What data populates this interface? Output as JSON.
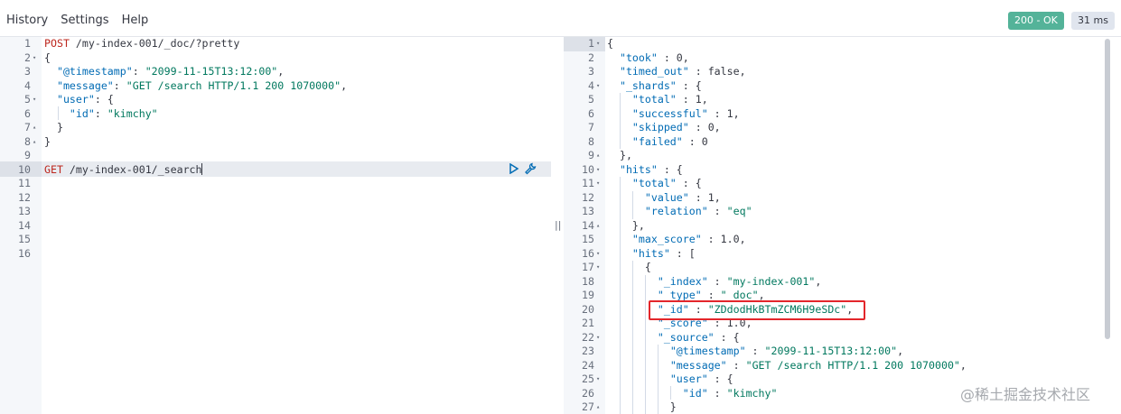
{
  "menu": {
    "history": "History",
    "settings": "Settings",
    "help": "Help"
  },
  "status": {
    "code": "200 - OK",
    "time": "31 ms",
    "ok_color": "#54b399"
  },
  "request": {
    "lines": [
      {
        "n": "1",
        "fold": "",
        "text": "POST /my-index-001/_doc/?pretty"
      },
      {
        "n": "2",
        "fold": "▾",
        "text": "{"
      },
      {
        "n": "3",
        "fold": "",
        "text": "  \"@timestamp\": \"2099-11-15T13:12:00\","
      },
      {
        "n": "4",
        "fold": "",
        "text": "  \"message\": \"GET /search HTTP/1.1 200 1070000\","
      },
      {
        "n": "5",
        "fold": "▾",
        "text": "  \"user\": {"
      },
      {
        "n": "6",
        "fold": "",
        "text": "    \"id\": \"kimchy\""
      },
      {
        "n": "7",
        "fold": "▴",
        "text": "  }"
      },
      {
        "n": "8",
        "fold": "▴",
        "text": "}"
      },
      {
        "n": "9",
        "fold": "",
        "text": ""
      },
      {
        "n": "10",
        "fold": "",
        "text": "GET /my-index-001/_search"
      },
      {
        "n": "11",
        "fold": "",
        "text": ""
      },
      {
        "n": "12",
        "fold": "",
        "text": ""
      },
      {
        "n": "13",
        "fold": "",
        "text": ""
      },
      {
        "n": "14",
        "fold": "",
        "text": ""
      },
      {
        "n": "15",
        "fold": "",
        "text": ""
      },
      {
        "n": "16",
        "fold": "",
        "text": ""
      }
    ]
  },
  "response": {
    "lines": [
      {
        "n": "1",
        "fold": "▾",
        "text": "{"
      },
      {
        "n": "2",
        "fold": "",
        "text": "  \"took\" : 0,"
      },
      {
        "n": "3",
        "fold": "",
        "text": "  \"timed_out\" : false,"
      },
      {
        "n": "4",
        "fold": "▾",
        "text": "  \"_shards\" : {"
      },
      {
        "n": "5",
        "fold": "",
        "text": "    \"total\" : 1,"
      },
      {
        "n": "6",
        "fold": "",
        "text": "    \"successful\" : 1,"
      },
      {
        "n": "7",
        "fold": "",
        "text": "    \"skipped\" : 0,"
      },
      {
        "n": "8",
        "fold": "",
        "text": "    \"failed\" : 0"
      },
      {
        "n": "9",
        "fold": "▴",
        "text": "  },"
      },
      {
        "n": "10",
        "fold": "▾",
        "text": "  \"hits\" : {"
      },
      {
        "n": "11",
        "fold": "▾",
        "text": "    \"total\" : {"
      },
      {
        "n": "12",
        "fold": "",
        "text": "      \"value\" : 1,"
      },
      {
        "n": "13",
        "fold": "",
        "text": "      \"relation\" : \"eq\""
      },
      {
        "n": "14",
        "fold": "▴",
        "text": "    },"
      },
      {
        "n": "15",
        "fold": "",
        "text": "    \"max_score\" : 1.0,"
      },
      {
        "n": "16",
        "fold": "▾",
        "text": "    \"hits\" : ["
      },
      {
        "n": "17",
        "fold": "▾",
        "text": "      {"
      },
      {
        "n": "18",
        "fold": "",
        "text": "        \"_index\" : \"my-index-001\","
      },
      {
        "n": "19",
        "fold": "",
        "text": "        \"_type\" : \"_doc\","
      },
      {
        "n": "20",
        "fold": "",
        "text": "        \"_id\" : \"ZDdodHkBTmZCM6H9eSDc\","
      },
      {
        "n": "21",
        "fold": "",
        "text": "        \"_score\" : 1.0,"
      },
      {
        "n": "22",
        "fold": "▾",
        "text": "        \"_source\" : {"
      },
      {
        "n": "23",
        "fold": "",
        "text": "          \"@timestamp\" : \"2099-11-15T13:12:00\","
      },
      {
        "n": "24",
        "fold": "",
        "text": "          \"message\" : \"GET /search HTTP/1.1 200 1070000\","
      },
      {
        "n": "25",
        "fold": "▾",
        "text": "          \"user\" : {"
      },
      {
        "n": "26",
        "fold": "",
        "text": "            \"id\" : \"kimchy\""
      },
      {
        "n": "27",
        "fold": "▴",
        "text": "          }"
      }
    ]
  },
  "watermark": "@稀土掘金技术社区",
  "divider": "||"
}
